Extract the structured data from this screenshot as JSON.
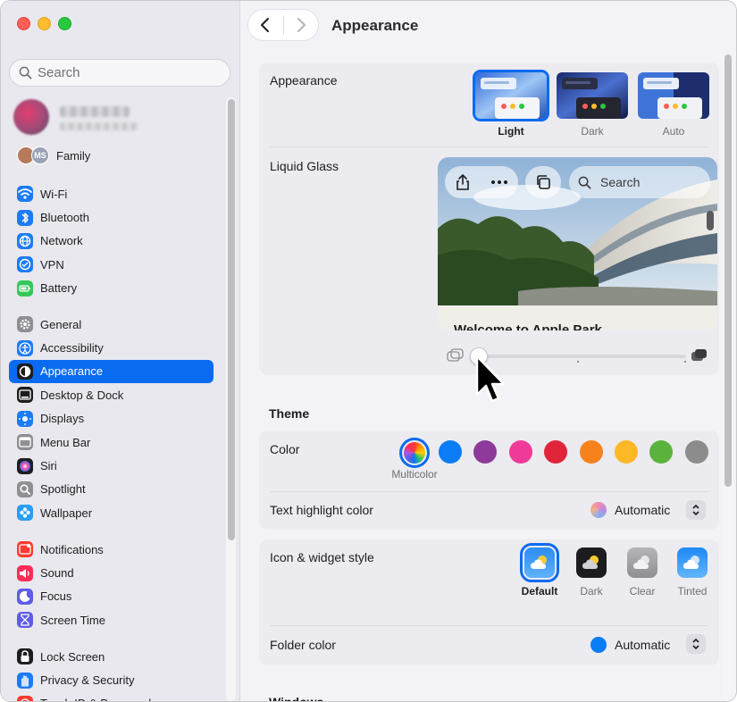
{
  "sidebar": {
    "search_placeholder": "Search",
    "family_label": "Family",
    "family_initials": "MS",
    "groups": [
      [
        {
          "label": "Wi-Fi",
          "icon": "wifi-icon",
          "color": "#1c7cf5"
        },
        {
          "label": "Bluetooth",
          "icon": "bluetooth-icon",
          "color": "#1c7cf5"
        },
        {
          "label": "Network",
          "icon": "globe-icon",
          "color": "#1c7cf5"
        },
        {
          "label": "VPN",
          "icon": "vpn-icon",
          "color": "#1c7cf5"
        },
        {
          "label": "Battery",
          "icon": "battery-icon",
          "color": "#34c759"
        }
      ],
      [
        {
          "label": "General",
          "icon": "gear-icon",
          "color": "#8e8e93"
        },
        {
          "label": "Accessibility",
          "icon": "accessibility-icon",
          "color": "#1c7cf5"
        },
        {
          "label": "Appearance",
          "icon": "appearance-icon",
          "color": "#1d1d1f",
          "active": true
        },
        {
          "label": "Desktop & Dock",
          "icon": "dock-icon",
          "color": "#1d1d1f"
        },
        {
          "label": "Displays",
          "icon": "sun-icon",
          "color": "#1c7cf5"
        },
        {
          "label": "Menu Bar",
          "icon": "menubar-icon",
          "color": "#8e8e93"
        },
        {
          "label": "Siri",
          "icon": "siri-icon",
          "color": "#1d1d1f"
        },
        {
          "label": "Spotlight",
          "icon": "magnifier-icon",
          "color": "#8e8e93"
        },
        {
          "label": "Wallpaper",
          "icon": "flower-icon",
          "color": "#2a9df4"
        }
      ],
      [
        {
          "label": "Notifications",
          "icon": "bell-icon",
          "color": "#ff3b30"
        },
        {
          "label": "Sound",
          "icon": "speaker-icon",
          "color": "#ff2d55"
        },
        {
          "label": "Focus",
          "icon": "moon-icon",
          "color": "#5e5ce6"
        },
        {
          "label": "Screen Time",
          "icon": "hourglass-icon",
          "color": "#5e5ce6"
        }
      ],
      [
        {
          "label": "Lock Screen",
          "icon": "lock-icon",
          "color": "#1d1d1f"
        },
        {
          "label": "Privacy & Security",
          "icon": "hand-icon",
          "color": "#1c7cf5"
        },
        {
          "label": "Touch ID & Password",
          "icon": "fingerprint-icon",
          "color": "#ff3b30"
        }
      ]
    ]
  },
  "main": {
    "title": "Appearance",
    "appearance_label": "Appearance",
    "appearance_options": [
      "Light",
      "Dark",
      "Auto"
    ],
    "appearance_selected": "Light",
    "liquid_glass_label": "Liquid Glass",
    "preview_search": "Search",
    "preview_heading": "Welcome to Apple Park",
    "liquid_glass_level": 0,
    "theme_title": "Theme",
    "color_label": "Color",
    "color_selected_caption": "Multicolor",
    "colors": [
      "#0a7cf5",
      "#8d3a9a",
      "#f03a97",
      "#e0253a",
      "#f7821b",
      "#fcb827",
      "#5bb33e",
      "#8c8c8c"
    ],
    "highlight_label": "Text highlight color",
    "highlight_value": "Automatic",
    "icon_style_label": "Icon & widget style",
    "icon_styles": [
      "Default",
      "Dark",
      "Clear",
      "Tinted"
    ],
    "icon_style_selected": "Default",
    "folder_label": "Folder color",
    "folder_value": "Automatic",
    "folder_color": "#0a7cf5",
    "windows_title": "Windows"
  }
}
